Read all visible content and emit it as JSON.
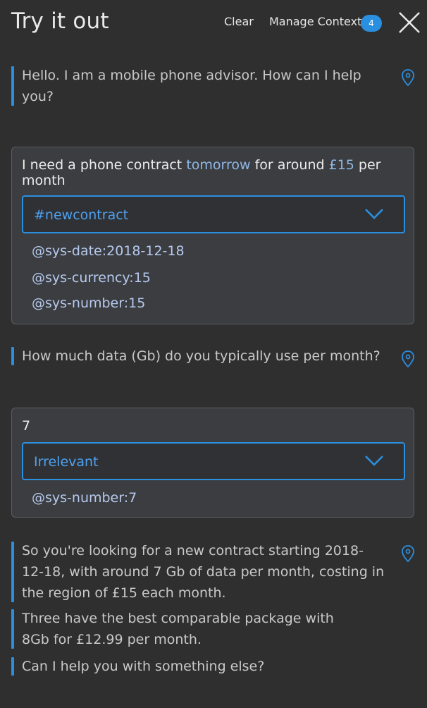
{
  "header": {
    "title": "Try it out",
    "clear_label": "Clear",
    "manage_context_label": "Manage Context",
    "context_count": "4",
    "close_icon": "close-icon"
  },
  "conversation": {
    "bot_greeting": "Hello. I am a mobile phone advisor. How can I help you?",
    "user_message_1": {
      "segments": [
        {
          "text": "I need a phone contract ",
          "entity": false
        },
        {
          "text": "tomorrow",
          "entity": true
        },
        {
          "text": " for around ",
          "entity": false
        },
        {
          "text": "£15",
          "entity": true
        },
        {
          "text": " per month",
          "entity": false
        }
      ],
      "intent": "#newcontract",
      "entities": [
        "@sys-date:2018-12-18",
        "@sys-currency:15",
        "@sys-number:15"
      ]
    },
    "bot_question": "How much data (Gb) do you typically use per month?",
    "user_message_2": {
      "text": "7",
      "intent": "Irrelevant",
      "entities": [
        "@sys-number:7"
      ]
    },
    "bot_summary": "So you're looking for a new contract starting 2018-12-18, with around 7 Gb of data per month, costing in the region of £15 each month.",
    "bot_recommendation": "Three have the best comparable package with 8Gb for £12.99 per month.",
    "bot_followup": "Can I help you with something else?"
  },
  "colors": {
    "background": "#2f2f2f",
    "accent": "#2b8fe0",
    "entity_highlight": "#8fb8e6",
    "card_background": "#3b3d40"
  }
}
